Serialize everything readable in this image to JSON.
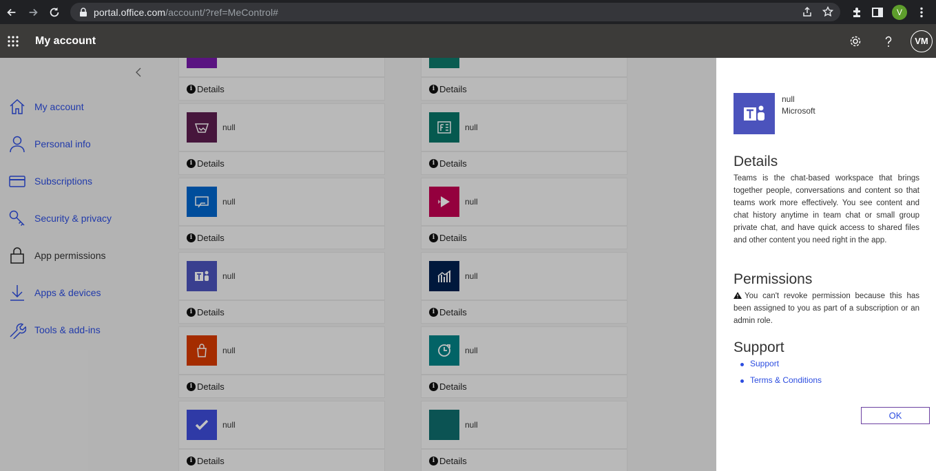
{
  "browser": {
    "url_host": "portal.office.com",
    "url_path": "/account/?ref=MeControl#",
    "profile_initial": "V"
  },
  "header": {
    "title": "My account",
    "avatar_initials": "VM"
  },
  "sidebar": {
    "items": [
      {
        "label": "My account",
        "icon": "home-icon"
      },
      {
        "label": "Personal info",
        "icon": "person-icon"
      },
      {
        "label": "Subscriptions",
        "icon": "card-icon"
      },
      {
        "label": "Security & privacy",
        "icon": "key-icon"
      },
      {
        "label": "App permissions",
        "icon": "lock-icon"
      },
      {
        "label": "Apps & devices",
        "icon": "download-icon"
      },
      {
        "label": "Tools & add-ins",
        "icon": "wrench-icon"
      }
    ]
  },
  "apps": {
    "details_label": "Details",
    "left": [
      {
        "name": "",
        "color": "#7719aa"
      },
      {
        "name": "null",
        "color": "#5c1e4f",
        "icon": "powerapps-icon"
      },
      {
        "name": "null",
        "color": "#0066cc",
        "icon": "flow-icon"
      },
      {
        "name": "null",
        "color": "#4b53bc",
        "icon": "teams-icon"
      },
      {
        "name": "null",
        "color": "#d83b01",
        "icon": "store-icon"
      },
      {
        "name": "null",
        "color": "#3f4ddb",
        "icon": "checkmark-icon"
      }
    ],
    "right": [
      {
        "name": "",
        "color": "#0e7a6b"
      },
      {
        "name": "null",
        "color": "#077568",
        "icon": "forms-icon"
      },
      {
        "name": "null",
        "color": "#c30052",
        "icon": "stream-icon"
      },
      {
        "name": "null",
        "color": "#002050",
        "icon": "chart-icon"
      },
      {
        "name": "null",
        "color": "#038387",
        "icon": "bookings-icon"
      },
      {
        "name": "null",
        "color": "#0f6e6e"
      }
    ]
  },
  "panel": {
    "app_name": "null",
    "publisher": "Microsoft",
    "details_heading": "Details",
    "details_text": "Teams is the chat-based workspace that brings together people, conversations and content so that teams work more effectively. You see content and chat history anytime in team chat or small group private chat, and have quick access to shared files and other content you need right in the app.",
    "permissions_heading": "Permissions",
    "permissions_text": "You can't revoke permission because this has been assigned to you as part of a subscription or an admin role.",
    "support_heading": "Support",
    "support_links": [
      "Support",
      "Terms & Conditions"
    ],
    "ok_label": "OK"
  }
}
